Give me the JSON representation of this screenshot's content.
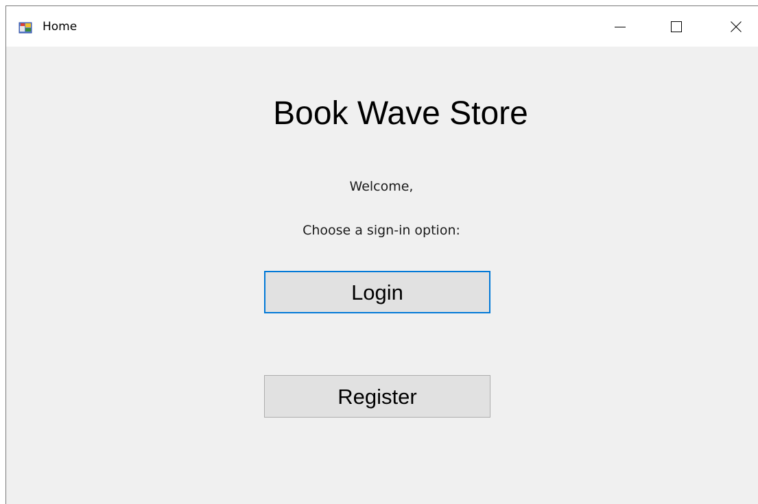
{
  "window": {
    "title": "Home",
    "app_icon": "winforms-app-icon",
    "controls": {
      "minimize_icon": "minimize-icon",
      "maximize_icon": "maximize-icon",
      "close_icon": "close-icon"
    }
  },
  "main": {
    "heading": "Book Wave Store",
    "welcome": "Welcome,",
    "prompt": "Choose a sign-in option:",
    "login_label": "Login",
    "register_label": "Register"
  },
  "colors": {
    "client_background": "#f0f0f0",
    "button_face": "#e1e1e1",
    "focus_border": "#0078d7"
  }
}
